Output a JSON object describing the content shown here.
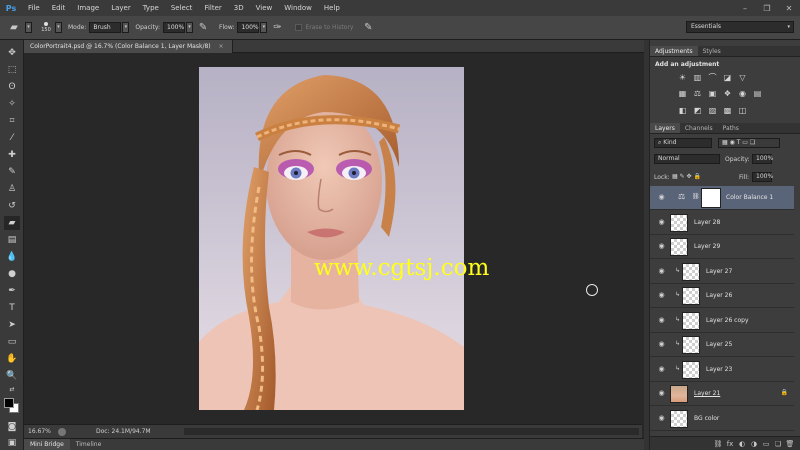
{
  "app": {
    "logo": "Ps"
  },
  "menu": [
    "File",
    "Edit",
    "Image",
    "Layer",
    "Type",
    "Select",
    "Filter",
    "3D",
    "View",
    "Window",
    "Help"
  ],
  "window_controls": [
    "–",
    "❐",
    "✕"
  ],
  "options_bar": {
    "brush_size": "150",
    "mode_label": "Mode:",
    "mode_value": "Brush",
    "opacity_label": "Opacity:",
    "opacity_value": "100%",
    "flow_label": "Flow:",
    "flow_value": "100%",
    "erase_history_label": "Erase to History",
    "workspace": "Essentials"
  },
  "document": {
    "tab_title": "ColorPortrait4.psd @ 16.7% (Color Balance 1, Layer Mask/8)",
    "tab_close": "×",
    "watermark": "www.cgtsj.com"
  },
  "status": {
    "zoom": "16.67%",
    "doc_size": "Doc: 24.1M/94.7M",
    "arrow": "▶"
  },
  "bottom_tabs": [
    "Mini Bridge",
    "Timeline"
  ],
  "adjust_panel": {
    "tabs": [
      "Adjustments",
      "Styles"
    ],
    "title": "Add an adjustment",
    "row1": [
      "☀",
      "▥",
      "⌒",
      "◪",
      "▽"
    ],
    "row2": [
      "▦",
      "⚖",
      "▣",
      "❖",
      "◉",
      "▤"
    ],
    "row3": [
      "◧",
      "◩",
      "▨",
      "▩",
      "◫"
    ]
  },
  "layers_panel": {
    "tabs": [
      "Layers",
      "Channels",
      "Paths"
    ],
    "filter_value": "Kind",
    "blend_mode": "Normal",
    "opacity_label": "Opacity:",
    "opacity_value": "100%",
    "lock_label": "Lock:",
    "fill_label": "Fill:",
    "fill_value": "100%",
    "layers": [
      {
        "name": "Color Balance 1",
        "selected": true,
        "clipped": false,
        "kind": "adjustment"
      },
      {
        "name": "Layer 28",
        "selected": false,
        "clipped": false,
        "kind": "pixel"
      },
      {
        "name": "Layer 29",
        "selected": false,
        "clipped": false,
        "kind": "pixel"
      },
      {
        "name": "Layer 27",
        "selected": false,
        "clipped": true,
        "kind": "pixel"
      },
      {
        "name": "Layer 26",
        "selected": false,
        "clipped": true,
        "kind": "pixel"
      },
      {
        "name": "Layer 26 copy",
        "selected": false,
        "clipped": true,
        "kind": "pixel"
      },
      {
        "name": "Layer 25",
        "selected": false,
        "clipped": true,
        "kind": "pixel"
      },
      {
        "name": "Layer 23",
        "selected": false,
        "clipped": true,
        "kind": "pixel"
      },
      {
        "name": "Layer 21",
        "selected": false,
        "clipped": false,
        "kind": "portrait"
      },
      {
        "name": "BG color",
        "selected": false,
        "clipped": false,
        "kind": "pixel"
      }
    ],
    "bottom_icons": [
      "⛓",
      "fx",
      "◐",
      "◑",
      "▭",
      "❏",
      "🗑"
    ]
  },
  "colors": {
    "accent": "#4a9ee6",
    "selection": "#5a6479",
    "watermark": "#ffff1a"
  }
}
